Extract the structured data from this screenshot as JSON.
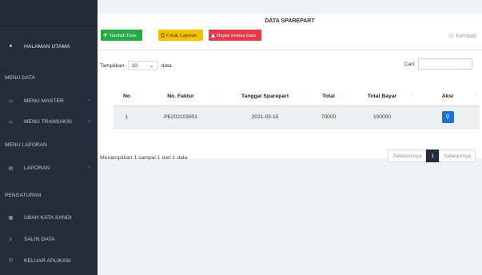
{
  "sidebar": {
    "home": {
      "label": "HALAMAN UTAMA",
      "icon": "home-icon"
    },
    "headers": {
      "data": "MENU DATA",
      "laporan": "MENU LAPORAN",
      "pengaturan": "PENGATURAN"
    },
    "items": [
      {
        "label": "MENU MASTER",
        "icon": "monitor-icon"
      },
      {
        "label": "MENU TRANSAKSI",
        "icon": "monitor-icon"
      },
      {
        "label": "LAPORAN",
        "icon": "report-icon"
      },
      {
        "label": "UBAH KATA SANDI",
        "icon": "grid-icon"
      },
      {
        "label": "SALIN DATA",
        "icon": "download-icon"
      },
      {
        "label": "KELUAR APLIKASI",
        "icon": "power-icon"
      }
    ]
  },
  "page": {
    "title": "DATA SPAREPART",
    "buttons": {
      "add": "Tambah Data",
      "print": "Cetak Laporan",
      "delete_all": "Hapus Semua Data"
    },
    "back": "Kembali"
  },
  "table_controls": {
    "show_label": "Tampilkan",
    "show_value": "10",
    "show_suffix": "data",
    "search_label": "Cari:",
    "search_value": ""
  },
  "table": {
    "columns": [
      "No",
      "No. Faktur",
      "Tanggal Sparepart",
      "Total",
      "Total Bayar",
      "Aksi"
    ],
    "rows": [
      {
        "no": "1",
        "faktur": "PE202103001",
        "tanggal": "2021-03-15",
        "total": "70000",
        "bayar": "100000"
      }
    ]
  },
  "footer": {
    "info": "Menampilkan 1 sampai 1 dari 1 data",
    "prev": "Sebelumnya",
    "current": "1",
    "next": "Selanjutnya"
  },
  "colors": {
    "sidebar": "#252c3a",
    "add": "#28a745",
    "print": "#f2c200",
    "delete": "#e23b4b",
    "action": "#1a73d9"
  }
}
